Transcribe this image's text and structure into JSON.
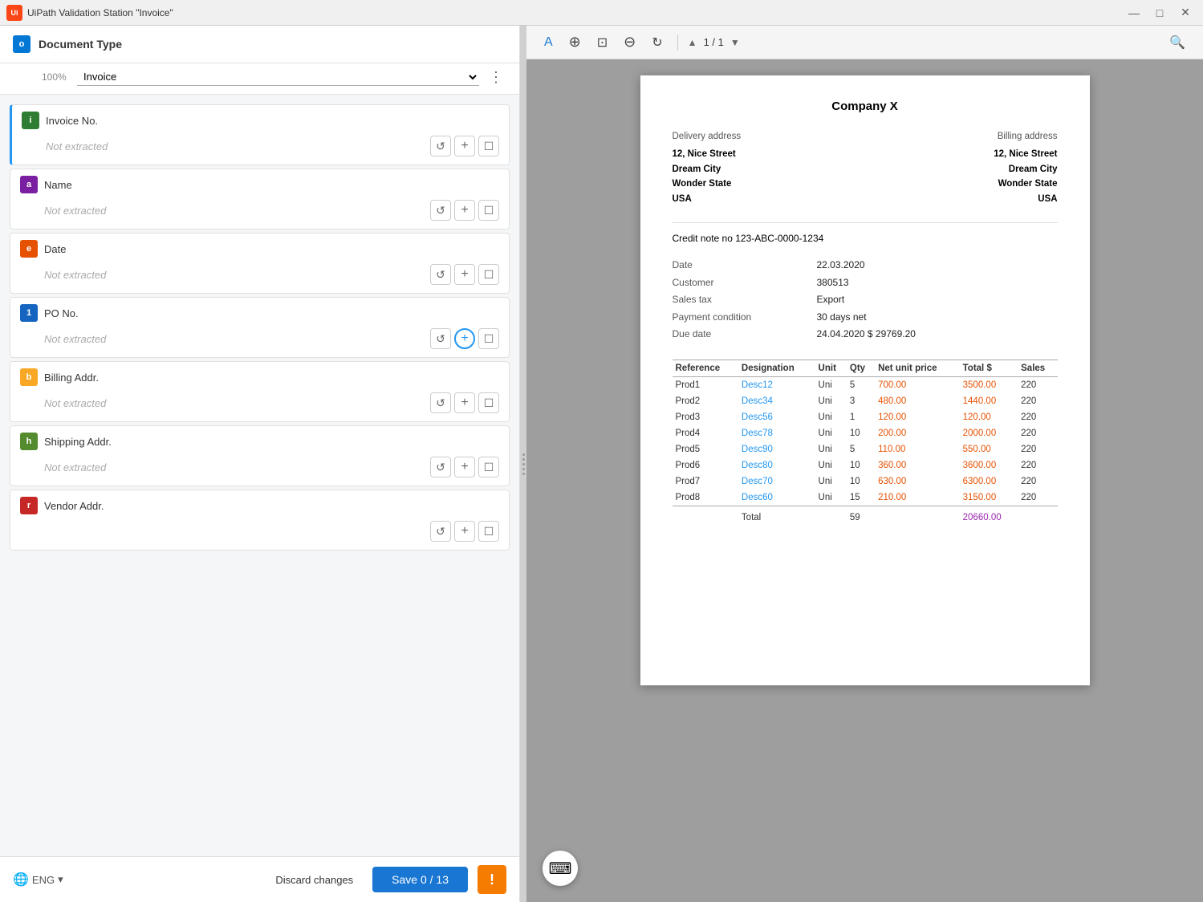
{
  "titleBar": {
    "appName": "UiPath Validation Station",
    "docName": "\"Invoice\"",
    "minimize": "—",
    "maximize": "□",
    "close": "✕"
  },
  "leftPanel": {
    "docType": {
      "iconLabel": "o",
      "iconColor": "#0078d4",
      "label": "Document Type",
      "confidence": "100%",
      "selectedValue": "Invoice",
      "moreLabel": "⋮"
    },
    "fields": [
      {
        "id": "invoice-no",
        "iconLabel": "i",
        "iconColor": "#2e7d32",
        "name": "Invoice No.",
        "value": "Not extracted",
        "active": true,
        "hasCirclePlus": false
      },
      {
        "id": "name",
        "iconLabel": "a",
        "iconColor": "#7b1fa2",
        "name": "Name",
        "value": "Not extracted",
        "active": false,
        "hasCirclePlus": false
      },
      {
        "id": "date",
        "iconLabel": "e",
        "iconColor": "#e65100",
        "name": "Date",
        "value": "Not extracted",
        "active": false,
        "hasCirclePlus": false
      },
      {
        "id": "po-no",
        "iconLabel": "1",
        "iconColor": "#1565c0",
        "name": "PO No.",
        "value": "Not extracted",
        "active": false,
        "hasCirclePlus": true
      },
      {
        "id": "billing-addr",
        "iconLabel": "b",
        "iconColor": "#f9a825",
        "name": "Billing Addr.",
        "value": "Not extracted",
        "active": false,
        "hasCirclePlus": false
      },
      {
        "id": "shipping-addr",
        "iconLabel": "h",
        "iconColor": "#558b2f",
        "name": "Shipping Addr.",
        "value": "Not extracted",
        "active": false,
        "hasCirclePlus": false
      },
      {
        "id": "vendor-addr",
        "iconLabel": "r",
        "iconColor": "#c62828",
        "name": "Vendor Addr.",
        "value": "",
        "active": false,
        "hasCirclePlus": false
      }
    ],
    "bottomToolbar": {
      "langLabel": "ENG",
      "discardLabel": "Discard changes",
      "saveLabel": "Save 0 / 13",
      "exclaimLabel": "!"
    }
  },
  "rightPanel": {
    "toolbar": {
      "textToolLabel": "A",
      "zoomInLabel": "⊕",
      "fitLabel": "⊞",
      "zoomOutLabel": "⊖",
      "rotateLabel": "↻",
      "searchLabel": "🔍",
      "currentPage": "1",
      "totalPages": "1"
    },
    "document": {
      "companyName": "Company X",
      "deliveryAddressLabel": "Delivery address",
      "deliveryAddressLines": [
        "12, Nice Street",
        "Dream City",
        "Wonder State",
        "USA"
      ],
      "billingAddressLabel": "Billing address",
      "billingAddressLines": [
        "12, Nice Street",
        "Dream City",
        "Wonder State",
        "USA"
      ],
      "creditNote": "Credit note no 123-ABC-0000-1234",
      "meta": [
        {
          "label": "Date",
          "value": "22.03.2020"
        },
        {
          "label": "Customer",
          "value": "380513"
        },
        {
          "label": "Sales tax",
          "value": "Export"
        },
        {
          "label": "Payment condition",
          "value": "30 days net"
        },
        {
          "label": "Due date",
          "value": "24.04.2020 $ 29769.20"
        }
      ],
      "tableHeaders": [
        "Reference",
        "Designation",
        "Unit",
        "Qty",
        "Net unit price",
        "Total $",
        "Sales"
      ],
      "tableRows": [
        {
          "ref": "Prod1",
          "desc": "Desc12",
          "unit": "Uni",
          "qty": "5",
          "price": "700.00",
          "total": "3500.00",
          "sales": "220"
        },
        {
          "ref": "Prod2",
          "desc": "Desc34",
          "unit": "Uni",
          "qty": "3",
          "price": "480.00",
          "total": "1440.00",
          "sales": "220"
        },
        {
          "ref": "Prod3",
          "desc": "Desc56",
          "unit": "Uni",
          "qty": "1",
          "price": "120.00",
          "total": "120.00",
          "sales": "220"
        },
        {
          "ref": "Prod4",
          "desc": "Desc78",
          "unit": "Uni",
          "qty": "10",
          "price": "200.00",
          "total": "2000.00",
          "sales": "220"
        },
        {
          "ref": "Prod5",
          "desc": "Desc90",
          "unit": "Uni",
          "qty": "5",
          "price": "110.00",
          "total": "550.00",
          "sales": "220"
        },
        {
          "ref": "Prod6",
          "desc": "Desc80",
          "unit": "Uni",
          "qty": "10",
          "price": "360.00",
          "total": "3600.00",
          "sales": "220"
        },
        {
          "ref": "Prod7",
          "desc": "Desc70",
          "unit": "Uni",
          "qty": "10",
          "price": "630.00",
          "total": "6300.00",
          "sales": "220"
        },
        {
          "ref": "Prod8",
          "desc": "Desc60",
          "unit": "Uni",
          "qty": "15",
          "price": "210.00",
          "total": "3150.00",
          "sales": "220"
        }
      ],
      "totalLabel": "Total",
      "totalQty": "59",
      "totalValue": "20660.00"
    }
  }
}
